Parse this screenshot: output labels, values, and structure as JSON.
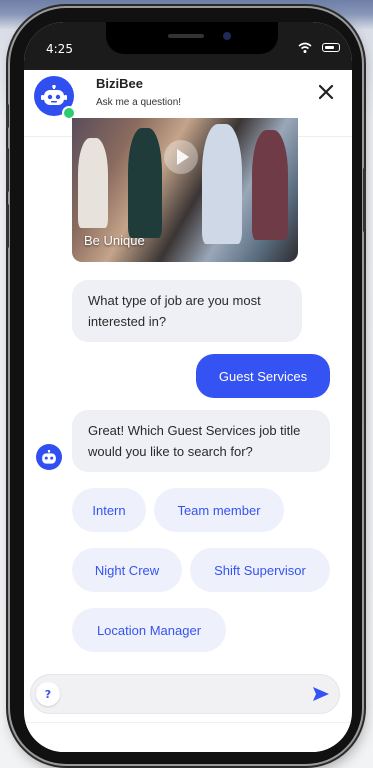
{
  "status_bar": {
    "time": "4:25",
    "icons": [
      "wifi-icon",
      "battery-icon"
    ]
  },
  "header": {
    "bot_name": "BiziBee",
    "subtitle": "Ask me a question!",
    "close_icon": "close-icon",
    "online": true
  },
  "chat": {
    "video": {
      "caption": "Be Unique",
      "icon": "play-icon"
    },
    "messages": [
      {
        "from": "bot",
        "text": "What type of job are you most interested in?"
      },
      {
        "from": "user",
        "text": "Guest Services"
      },
      {
        "from": "bot",
        "text": "Great! Which Guest Services job title would you like to search for?"
      }
    ],
    "options": [
      "Intern",
      "Team member",
      "Night Crew",
      "Shift Supervisor",
      "Location Manager"
    ]
  },
  "composer": {
    "help_label": "?",
    "placeholder": "",
    "send_icon": "send-icon"
  },
  "colors": {
    "accent": "#3553f2",
    "bubble_bot": "#eef0f6",
    "chip_bg": "#eef1fb",
    "online": "#2dcc70"
  }
}
